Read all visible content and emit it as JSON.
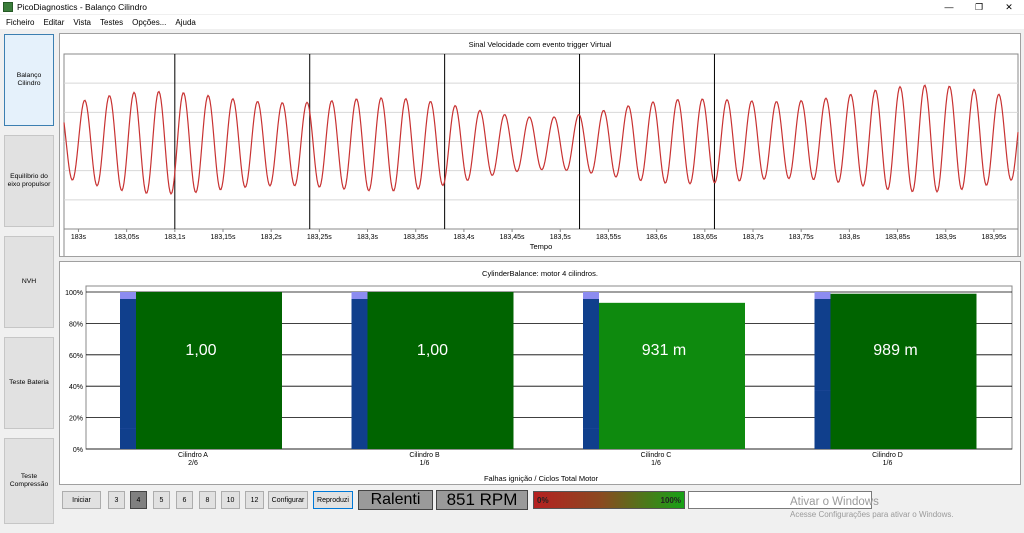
{
  "window": {
    "title": "PicoDiagnostics - Balanço Cilindro",
    "minimize": "—",
    "restore": "❐",
    "close": "✕"
  },
  "menu": [
    "Ficheiro",
    "Editar",
    "Vista",
    "Testes",
    "Opções...",
    "Ajuda"
  ],
  "sidebar": [
    {
      "line1": "Balanço",
      "line2": "Cilindro",
      "active": true
    },
    {
      "line1": "Equilíbrio do",
      "line2": "eixo propulsor",
      "active": false
    },
    {
      "line1": "NVH",
      "line2": "",
      "active": false
    },
    {
      "line1": "Teste Bateria",
      "line2": "",
      "active": false
    },
    {
      "line1": "Teste",
      "line2": "Compressão",
      "active": false
    }
  ],
  "signal_chart": {
    "title": "Sinal Velocidade com evento trigger Virtual",
    "xlabel": "Tempo",
    "line_color": "#c83232",
    "x_ticks": [
      "183s",
      "183,05s",
      "183,1s",
      "183,15s",
      "183,2s",
      "183,25s",
      "183,3s",
      "183,35s",
      "183,4s",
      "183,45s",
      "183,5s",
      "183,55s",
      "183,6s",
      "183,65s",
      "183,7s",
      "183,75s",
      "183,8s",
      "183,85s",
      "183,9s",
      "183,95s"
    ],
    "trigger_times": [
      183.1,
      183.24,
      183.38,
      183.52,
      183.66
    ]
  },
  "balance_chart": {
    "title": "CylinderBalance: motor 4 cilindros.",
    "footer": "Falhas ignição / Ciclos Total Motor",
    "y_ticks": [
      "100%",
      "80%",
      "60%",
      "40%",
      "20%",
      "0%"
    ],
    "colors": {
      "main": "#006400",
      "main_c": "#0e8a0e",
      "blue": "#103f8c",
      "cap": "#8c8cf0"
    },
    "cylinders": [
      {
        "name": "Cilindro A",
        "ratio": "2/6",
        "label": "1,00",
        "value": 100,
        "blue": 100,
        "blue_solid": 13
      },
      {
        "name": "Cilindro B",
        "ratio": "1/6",
        "label": "1,00",
        "value": 100,
        "blue": 100,
        "blue_solid": 100
      },
      {
        "name": "Cilindro C",
        "ratio": "1/6",
        "label": "931 m",
        "value": 93.1,
        "blue": 100,
        "blue_solid": 13
      },
      {
        "name": "Cilindro D",
        "ratio": "1/6",
        "label": "989 m",
        "value": 98.9,
        "blue": 100,
        "blue_solid": 37
      }
    ]
  },
  "toolbar": {
    "start": "Iniciar",
    "counts": [
      "3",
      "4",
      "5",
      "6",
      "8",
      "10",
      "12"
    ],
    "selected_count": "4",
    "configure": "Configurar",
    "play": "Reproduzi",
    "mode": "Ralenti",
    "rpm": "851 RPM",
    "gauge_min": "0%",
    "gauge_max": "100%"
  },
  "watermark": {
    "line1": "Ativar o Windows",
    "line2": "Acesse Configurações para ativar o Windows."
  }
}
